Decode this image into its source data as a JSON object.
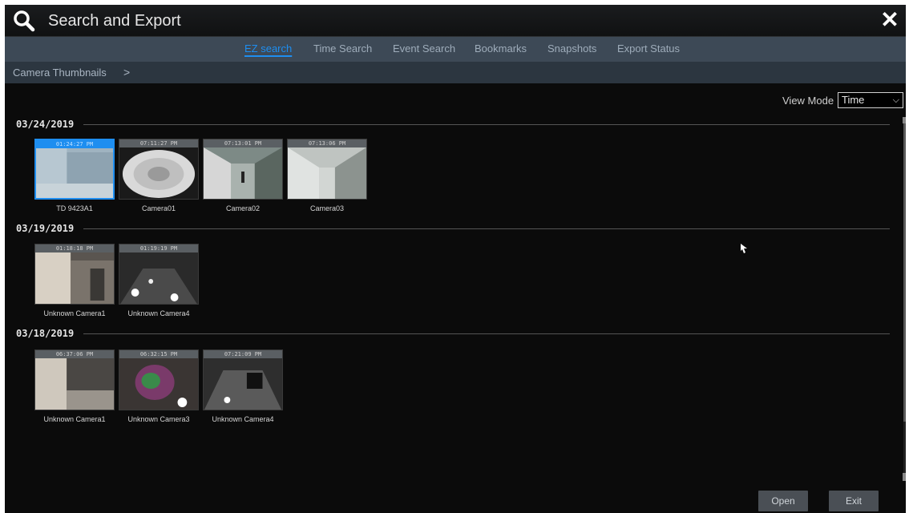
{
  "window": {
    "title": "Search and Export",
    "close_symbol": "✕"
  },
  "tabs": [
    {
      "label": "EZ search",
      "active": true
    },
    {
      "label": "Time Search",
      "active": false
    },
    {
      "label": "Event Search",
      "active": false
    },
    {
      "label": "Bookmarks",
      "active": false
    },
    {
      "label": "Snapshots",
      "active": false
    },
    {
      "label": "Export Status",
      "active": false
    }
  ],
  "breadcrumb": {
    "label": "Camera Thumbnails",
    "arrow": ">"
  },
  "view_mode": {
    "label": "View Mode",
    "value": "Time"
  },
  "groups": [
    {
      "date": "03/24/2019",
      "items": [
        {
          "time": "01:24:27 PM",
          "camera": "TD 9423A1",
          "scene": "room",
          "selected": true
        },
        {
          "time": "07:11:27 PM",
          "camera": "Camera01",
          "scene": "fisheye",
          "selected": false
        },
        {
          "time": "07:13:01 PM",
          "camera": "Camera02",
          "scene": "corridor",
          "selected": false
        },
        {
          "time": "07:13:06 PM",
          "camera": "Camera03",
          "scene": "hall",
          "selected": false
        }
      ]
    },
    {
      "date": "03/19/2019",
      "items": [
        {
          "time": "01:18:18 PM",
          "camera": "Unknown Camera1",
          "scene": "door",
          "selected": false
        },
        {
          "time": "01:19:19 PM",
          "camera": "Unknown Camera4",
          "scene": "floor",
          "selected": false
        }
      ]
    },
    {
      "date": "03/18/2019",
      "items": [
        {
          "time": "06:37:06 PM",
          "camera": "Unknown Camera1",
          "scene": "door2",
          "selected": false
        },
        {
          "time": "06:32:15 PM",
          "camera": "Unknown Camera3",
          "scene": "person",
          "selected": false
        },
        {
          "time": "07:21:09 PM",
          "camera": "Unknown Camera4",
          "scene": "floor2",
          "selected": false
        }
      ]
    }
  ],
  "buttons": {
    "open": "Open",
    "exit": "Exit"
  },
  "colors": {
    "accent": "#1e8ef0",
    "tabbar": "#3d4956",
    "crumbbar": "#2c3640",
    "background": "#0b0b0b"
  }
}
